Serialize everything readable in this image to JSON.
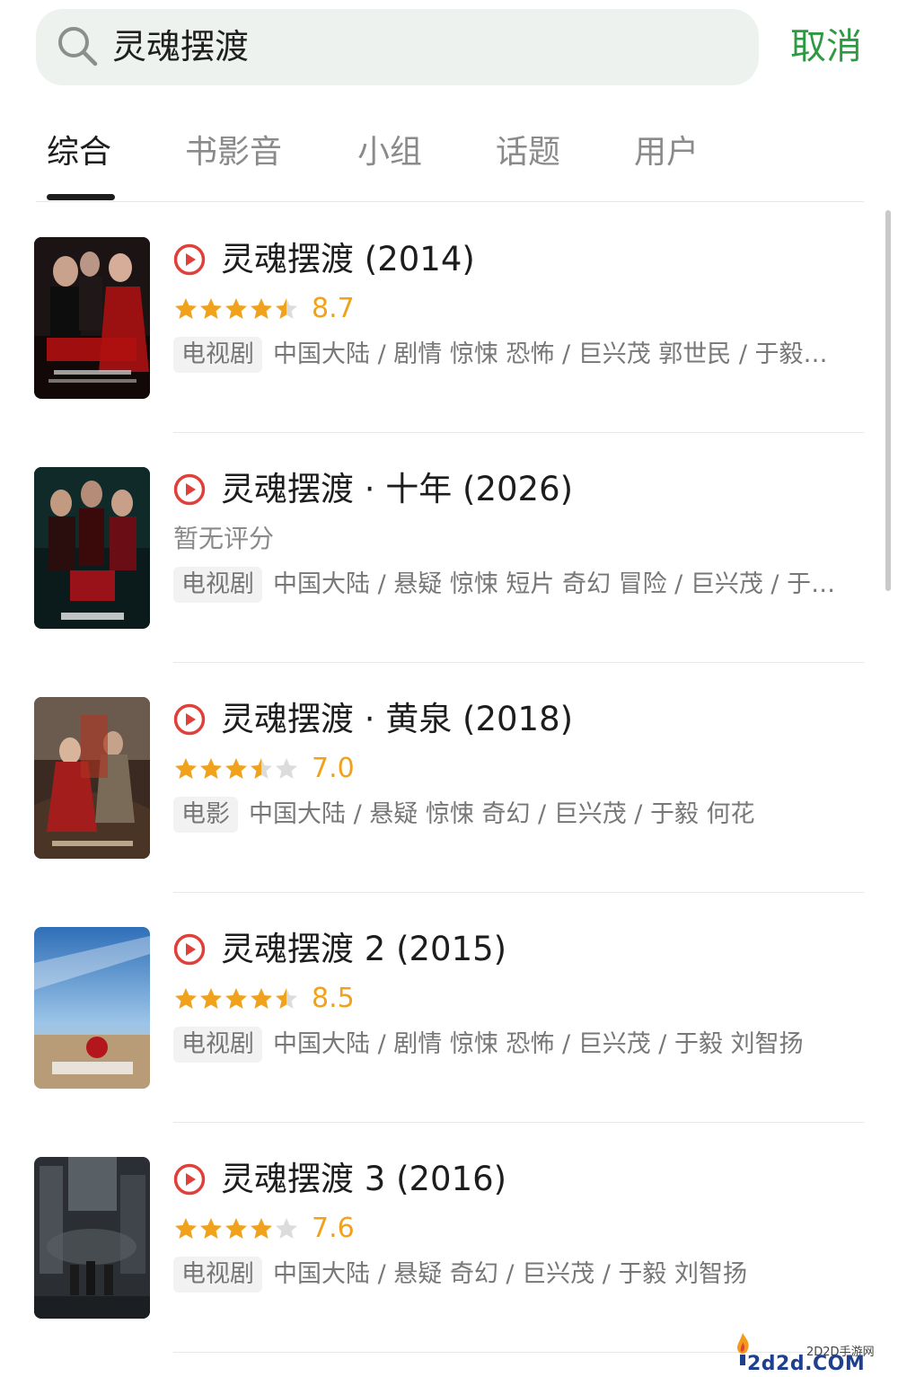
{
  "search": {
    "query": "灵魂摆渡",
    "cancel_label": "取消"
  },
  "tabs": [
    {
      "label": "综合",
      "active": true
    },
    {
      "label": "书影音",
      "active": false
    },
    {
      "label": "小组",
      "active": false
    },
    {
      "label": "话题",
      "active": false
    },
    {
      "label": "用户",
      "active": false
    }
  ],
  "results": [
    {
      "title": "灵魂摆渡 (2014)",
      "rating": 8.7,
      "score_text": "8.7",
      "stars": 4.5,
      "type_badge": "电视剧",
      "meta": "中国大陆 / 剧情 惊悚 恐怖 / 巨兴茂 郭世民 / 于毅…"
    },
    {
      "title": "灵魂摆渡 · 十年 (2026)",
      "rating": null,
      "score_text": "暂无评分",
      "stars": 0,
      "type_badge": "电视剧",
      "meta": "中国大陆 / 悬疑 惊悚 短片 奇幻 冒险 / 巨兴茂 / 于…"
    },
    {
      "title": "灵魂摆渡 · 黄泉 (2018)",
      "rating": 7.0,
      "score_text": "7.0",
      "stars": 3.5,
      "type_badge": "电影",
      "meta": "中国大陆 / 悬疑 惊悚 奇幻 / 巨兴茂 / 于毅 何花"
    },
    {
      "title": "灵魂摆渡 2 (2015)",
      "rating": 8.5,
      "score_text": "8.5",
      "stars": 4.5,
      "type_badge": "电视剧",
      "meta": "中国大陆 / 剧情 惊悚 恐怖 / 巨兴茂 / 于毅 刘智扬"
    },
    {
      "title": "灵魂摆渡 3 (2016)",
      "rating": 7.6,
      "score_text": "7.6",
      "stars": 4,
      "type_badge": "电视剧",
      "meta": "中国大陆 / 悬疑 奇幻 / 巨兴茂 / 于毅 刘智扬"
    }
  ],
  "watermark": {
    "small": "2D2D手游网",
    "big": "2d2d.COM"
  },
  "colors": {
    "accent_green": "#2d9a42",
    "star_orange": "#f0a21d",
    "play_red": "#e0403a"
  }
}
